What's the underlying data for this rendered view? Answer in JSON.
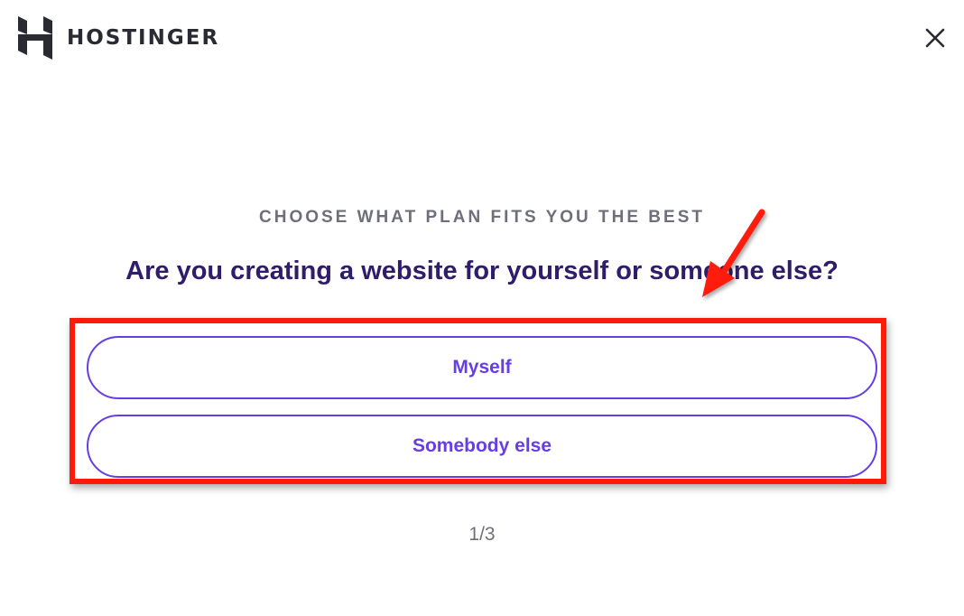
{
  "header": {
    "brand_name": "HOSTINGER",
    "logo_icon": "hostinger-logo-icon",
    "close_icon": "close-icon"
  },
  "main": {
    "kicker": "CHOOSE WHAT PLAN FITS YOU THE BEST",
    "question": "Are you creating a website for yourself or someone else?",
    "options": [
      {
        "label": "Myself"
      },
      {
        "label": "Somebody else"
      }
    ],
    "step_indicator": "1/3"
  },
  "annotations": {
    "highlight_color": "#ff1a0a",
    "arrow_icon": "red-arrow-icon"
  },
  "colors": {
    "accent": "#673de6",
    "question_text": "#2f1c6a",
    "muted_text": "#6e6f7a"
  }
}
